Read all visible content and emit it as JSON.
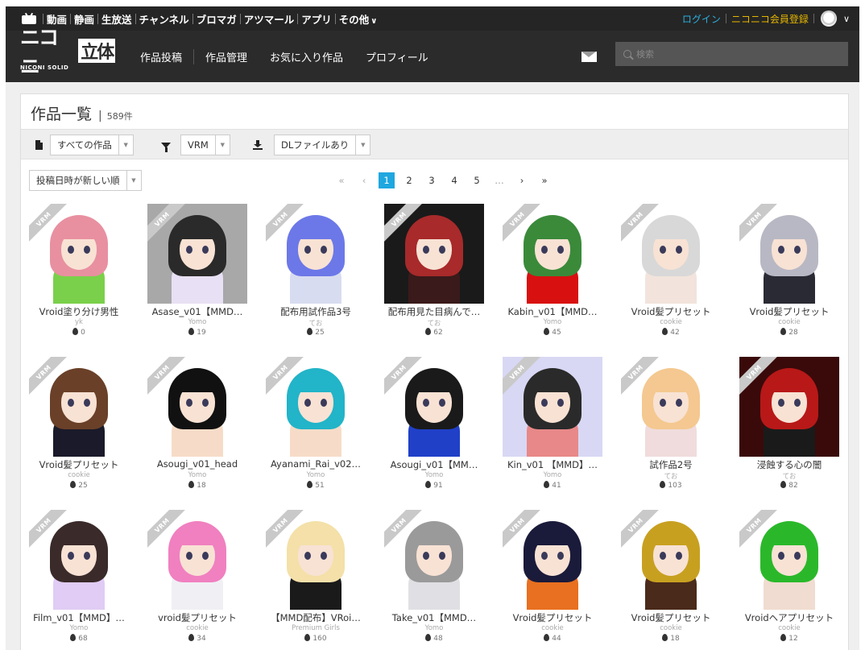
{
  "topbar": {
    "nav": [
      "動画",
      "静画",
      "生放送",
      "チャンネル",
      "ブロマガ",
      "アツマール",
      "アプリ",
      "その他"
    ],
    "more_chevron": "∨",
    "login": "ログイン",
    "register": "ニコニコ会員登録",
    "avatar_chevron": "∨"
  },
  "header": {
    "logo_main": "ニコニ",
    "logo_box": "立体",
    "logo_sub": "NICONI SOLID",
    "nav": [
      "作品投稿",
      "作品管理",
      "お気に入り作品",
      "プロフィール"
    ],
    "search_placeholder": "検索"
  },
  "panel": {
    "title": "作品一覧",
    "separator": "|",
    "count": "589件",
    "filters": {
      "type": "すべての作品",
      "format": "VRM",
      "download": "DLファイルあり",
      "arrow": "▼"
    },
    "sort": "投稿日時が新しい順",
    "pager": {
      "first": "«",
      "prev": "‹",
      "pages": [
        "1",
        "2",
        "3",
        "4",
        "5"
      ],
      "active": "1",
      "dots": "…",
      "next": "›",
      "last": "»"
    }
  },
  "badge_label": "VRM",
  "items": [
    {
      "title": "Vroid塗り分け男性",
      "author": "yk",
      "likes": "0",
      "bg": "#ffffff",
      "hair": "#e890a0",
      "body": "#7ad04a"
    },
    {
      "title": "Asase_v01【MMD…",
      "author": "Yomo",
      "likes": "19",
      "bg": "#a8a8a8",
      "hair": "#2a2a2a",
      "body": "#e8e0f4"
    },
    {
      "title": "配布用試作品3号",
      "author": "てお",
      "likes": "25",
      "bg": "#ffffff",
      "hair": "#6c78e8",
      "body": "#d8dcf0"
    },
    {
      "title": "配布用見た目病んで…",
      "author": "てお",
      "likes": "62",
      "bg": "#1a1a1a",
      "hair": "#a82a2a",
      "body": "#3a1a1a"
    },
    {
      "title": "Kabin_v01【MMD…",
      "author": "Yomo",
      "likes": "45",
      "bg": "#ffffff",
      "hair": "#3a8a3a",
      "body": "#d81010"
    },
    {
      "title": "Vroid髪プリセット",
      "author": "cookie",
      "likes": "42",
      "bg": "#ffffff",
      "hair": "#d8d8d8",
      "body": "#f2e4dc"
    },
    {
      "title": "Vroid髪プリセット",
      "author": "cookie",
      "likes": "28",
      "bg": "#ffffff",
      "hair": "#b8b8c4",
      "body": "#2a2a34"
    },
    {
      "title": "Vroid髪プリセット",
      "author": "cookie",
      "likes": "25",
      "bg": "#ffffff",
      "hair": "#6a4028",
      "body": "#1a1a2a"
    },
    {
      "title": "Asougi_v01_head",
      "author": "Yomo",
      "likes": "18",
      "bg": "#ffffff",
      "hair": "#111111",
      "body": "#f6dcc8"
    },
    {
      "title": "Ayanami_Rai_v02…",
      "author": "Yomo",
      "likes": "51",
      "bg": "#ffffff",
      "hair": "#22b4c8",
      "body": "#f6dcc8"
    },
    {
      "title": "Asougi_v01【MM…",
      "author": "Yomo",
      "likes": "91",
      "bg": "#ffffff",
      "hair": "#1a1a1a",
      "body": "#2040c8"
    },
    {
      "title": "Kin_v01 【MMD】…",
      "author": "Yomo",
      "likes": "41",
      "bg": "#d8d8f4",
      "hair": "#2a2a2a",
      "body": "#e88888"
    },
    {
      "title": "試作品2号",
      "author": "てお",
      "likes": "103",
      "bg": "#ffffff",
      "hair": "#f4c890",
      "body": "#f0dcdc"
    },
    {
      "title": "浸蝕する心の闇",
      "author": "てお",
      "likes": "82",
      "bg": "#3a0a0a",
      "hair": "#b81818",
      "body": "#1a1a1a"
    },
    {
      "title": "Film_v01【MMD】…",
      "author": "Yomo",
      "likes": "68",
      "bg": "#ffffff",
      "hair": "#3a2a2a",
      "body": "#e0ccf4"
    },
    {
      "title": "vroid髪プリセット",
      "author": "cookie",
      "likes": "34",
      "bg": "#ffffff",
      "hair": "#f080c0",
      "body": "#f0f0f4"
    },
    {
      "title": "【MMD配布】VRoi…",
      "author": "Premium Girls",
      "likes": "160",
      "bg": "#ffffff",
      "hair": "#f4e0a8",
      "body": "#1a1a1a"
    },
    {
      "title": "Take_v01【MMD…",
      "author": "Yomo",
      "likes": "48",
      "bg": "#ffffff",
      "hair": "#9a9a9a",
      "body": "#e0e0e4"
    },
    {
      "title": "Vroid髪プリセット",
      "author": "cookie",
      "likes": "44",
      "bg": "#ffffff",
      "hair": "#1a1a3a",
      "body": "#e87020"
    },
    {
      "title": "Vroid髪プリセット",
      "author": "cookie",
      "likes": "18",
      "bg": "#ffffff",
      "hair": "#c8a020",
      "body": "#4a2a1a"
    },
    {
      "title": "Vroidヘアプリセット",
      "author": "cookie",
      "likes": "12",
      "bg": "#ffffff",
      "hair": "#2ab82a",
      "body": "#f0dcd0"
    }
  ]
}
